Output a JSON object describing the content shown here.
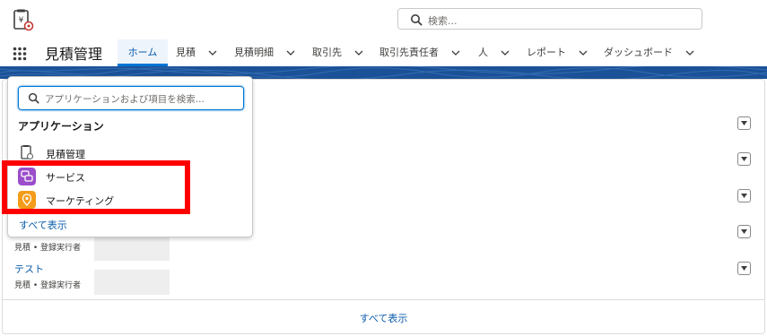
{
  "header": {
    "search_placeholder": "検索..."
  },
  "nav": {
    "app_name": "見積管理",
    "tabs": [
      {
        "label": "ホーム"
      },
      {
        "label": "見積"
      },
      {
        "label": "見積明細"
      },
      {
        "label": "取引先"
      },
      {
        "label": "取引先責任者"
      },
      {
        "label": "人"
      },
      {
        "label": "レポート"
      },
      {
        "label": "ダッシュボード"
      }
    ]
  },
  "launcher": {
    "search_placeholder": "アプリケーションおよび項目を検索...",
    "heading": "アプリケーション",
    "apps": [
      {
        "label": "見積管理",
        "icon": "quote-app-icon"
      },
      {
        "label": "サービス",
        "icon": "service-app-icon",
        "color": "#9b4dca"
      },
      {
        "label": "マーケティング",
        "icon": "marketing-app-icon",
        "color": "#f49c19"
      }
    ],
    "view_all": "すべて表示"
  },
  "records": [
    {
      "title": "",
      "meta": "見積 • 登録実行者"
    },
    {
      "title": "テスト",
      "meta": "見積 • 登録実行者"
    }
  ],
  "footer": {
    "view_all": "すべて表示"
  },
  "colors": {
    "brand_band": "#1b5297",
    "link": "#0b5cab",
    "active_tab_border": "#0176d3",
    "highlight": "#ff0000"
  }
}
